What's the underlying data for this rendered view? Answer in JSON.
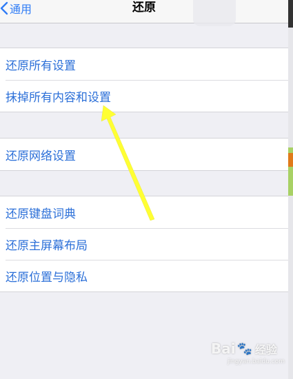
{
  "nav": {
    "back_label": "通用",
    "title": "还原"
  },
  "groups": [
    {
      "items": [
        "还原所有设置",
        "抹掉所有内容和设置"
      ]
    },
    {
      "items": [
        "还原网络设置"
      ]
    },
    {
      "items": [
        "还原键盘词典",
        "还原主屏幕布局",
        "还原位置与隐私"
      ]
    }
  ],
  "annotation": {
    "color": "#ffff33",
    "icon": "arrow-annotation-icon"
  },
  "watermark": {
    "text": "Bai",
    "paw": "🐾",
    "cn": "经验",
    "sub": "jingyan.baidu.com"
  },
  "colors": {
    "accent": "#2f7cf6",
    "item_text": "#2b6fd8",
    "background": "#efeff4"
  }
}
